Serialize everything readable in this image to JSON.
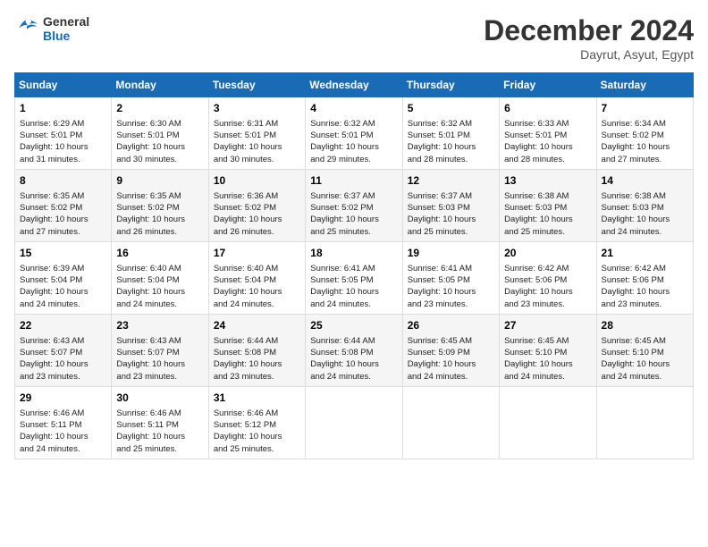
{
  "header": {
    "logo_line1": "General",
    "logo_line2": "Blue",
    "month_year": "December 2024",
    "location": "Dayrut, Asyut, Egypt"
  },
  "days_of_week": [
    "Sunday",
    "Monday",
    "Tuesday",
    "Wednesday",
    "Thursday",
    "Friday",
    "Saturday"
  ],
  "weeks": [
    [
      {
        "day": "1",
        "info": "Sunrise: 6:29 AM\nSunset: 5:01 PM\nDaylight: 10 hours\nand 31 minutes."
      },
      {
        "day": "2",
        "info": "Sunrise: 6:30 AM\nSunset: 5:01 PM\nDaylight: 10 hours\nand 30 minutes."
      },
      {
        "day": "3",
        "info": "Sunrise: 6:31 AM\nSunset: 5:01 PM\nDaylight: 10 hours\nand 30 minutes."
      },
      {
        "day": "4",
        "info": "Sunrise: 6:32 AM\nSunset: 5:01 PM\nDaylight: 10 hours\nand 29 minutes."
      },
      {
        "day": "5",
        "info": "Sunrise: 6:32 AM\nSunset: 5:01 PM\nDaylight: 10 hours\nand 28 minutes."
      },
      {
        "day": "6",
        "info": "Sunrise: 6:33 AM\nSunset: 5:01 PM\nDaylight: 10 hours\nand 28 minutes."
      },
      {
        "day": "7",
        "info": "Sunrise: 6:34 AM\nSunset: 5:02 PM\nDaylight: 10 hours\nand 27 minutes."
      }
    ],
    [
      {
        "day": "8",
        "info": "Sunrise: 6:35 AM\nSunset: 5:02 PM\nDaylight: 10 hours\nand 27 minutes."
      },
      {
        "day": "9",
        "info": "Sunrise: 6:35 AM\nSunset: 5:02 PM\nDaylight: 10 hours\nand 26 minutes."
      },
      {
        "day": "10",
        "info": "Sunrise: 6:36 AM\nSunset: 5:02 PM\nDaylight: 10 hours\nand 26 minutes."
      },
      {
        "day": "11",
        "info": "Sunrise: 6:37 AM\nSunset: 5:02 PM\nDaylight: 10 hours\nand 25 minutes."
      },
      {
        "day": "12",
        "info": "Sunrise: 6:37 AM\nSunset: 5:03 PM\nDaylight: 10 hours\nand 25 minutes."
      },
      {
        "day": "13",
        "info": "Sunrise: 6:38 AM\nSunset: 5:03 PM\nDaylight: 10 hours\nand 25 minutes."
      },
      {
        "day": "14",
        "info": "Sunrise: 6:38 AM\nSunset: 5:03 PM\nDaylight: 10 hours\nand 24 minutes."
      }
    ],
    [
      {
        "day": "15",
        "info": "Sunrise: 6:39 AM\nSunset: 5:04 PM\nDaylight: 10 hours\nand 24 minutes."
      },
      {
        "day": "16",
        "info": "Sunrise: 6:40 AM\nSunset: 5:04 PM\nDaylight: 10 hours\nand 24 minutes."
      },
      {
        "day": "17",
        "info": "Sunrise: 6:40 AM\nSunset: 5:04 PM\nDaylight: 10 hours\nand 24 minutes."
      },
      {
        "day": "18",
        "info": "Sunrise: 6:41 AM\nSunset: 5:05 PM\nDaylight: 10 hours\nand 24 minutes."
      },
      {
        "day": "19",
        "info": "Sunrise: 6:41 AM\nSunset: 5:05 PM\nDaylight: 10 hours\nand 23 minutes."
      },
      {
        "day": "20",
        "info": "Sunrise: 6:42 AM\nSunset: 5:06 PM\nDaylight: 10 hours\nand 23 minutes."
      },
      {
        "day": "21",
        "info": "Sunrise: 6:42 AM\nSunset: 5:06 PM\nDaylight: 10 hours\nand 23 minutes."
      }
    ],
    [
      {
        "day": "22",
        "info": "Sunrise: 6:43 AM\nSunset: 5:07 PM\nDaylight: 10 hours\nand 23 minutes."
      },
      {
        "day": "23",
        "info": "Sunrise: 6:43 AM\nSunset: 5:07 PM\nDaylight: 10 hours\nand 23 minutes."
      },
      {
        "day": "24",
        "info": "Sunrise: 6:44 AM\nSunset: 5:08 PM\nDaylight: 10 hours\nand 23 minutes."
      },
      {
        "day": "25",
        "info": "Sunrise: 6:44 AM\nSunset: 5:08 PM\nDaylight: 10 hours\nand 24 minutes."
      },
      {
        "day": "26",
        "info": "Sunrise: 6:45 AM\nSunset: 5:09 PM\nDaylight: 10 hours\nand 24 minutes."
      },
      {
        "day": "27",
        "info": "Sunrise: 6:45 AM\nSunset: 5:10 PM\nDaylight: 10 hours\nand 24 minutes."
      },
      {
        "day": "28",
        "info": "Sunrise: 6:45 AM\nSunset: 5:10 PM\nDaylight: 10 hours\nand 24 minutes."
      }
    ],
    [
      {
        "day": "29",
        "info": "Sunrise: 6:46 AM\nSunset: 5:11 PM\nDaylight: 10 hours\nand 24 minutes."
      },
      {
        "day": "30",
        "info": "Sunrise: 6:46 AM\nSunset: 5:11 PM\nDaylight: 10 hours\nand 25 minutes."
      },
      {
        "day": "31",
        "info": "Sunrise: 6:46 AM\nSunset: 5:12 PM\nDaylight: 10 hours\nand 25 minutes."
      },
      {
        "day": "",
        "info": ""
      },
      {
        "day": "",
        "info": ""
      },
      {
        "day": "",
        "info": ""
      },
      {
        "day": "",
        "info": ""
      }
    ]
  ]
}
